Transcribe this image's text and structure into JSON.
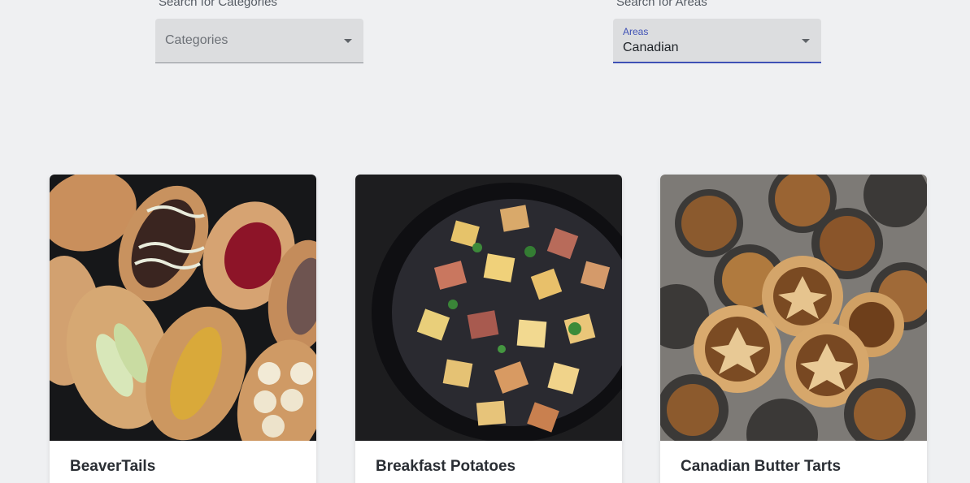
{
  "filters": {
    "categories": {
      "label": "Search for Categories",
      "placeholder": "Categories"
    },
    "areas": {
      "label": "Search for Areas",
      "float_label": "Areas",
      "value": "Canadian"
    }
  },
  "meals": [
    {
      "title": "BeaverTails"
    },
    {
      "title": "Breakfast Potatoes"
    },
    {
      "title": "Canadian Butter Tarts"
    }
  ]
}
